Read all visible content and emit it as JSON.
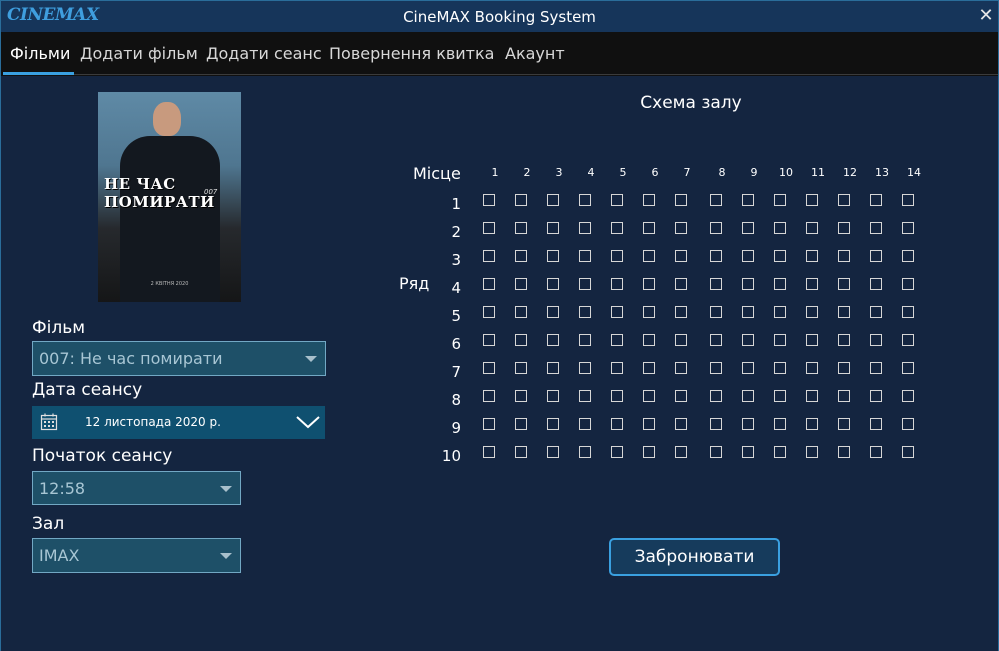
{
  "titlebar": {
    "logo": "CINEMAX",
    "title": "CineMAX Booking System",
    "close": "✕"
  },
  "tabs": [
    {
      "label": "Фільми",
      "active": true
    },
    {
      "label": "Додати фільм",
      "active": false
    },
    {
      "label": "Додати сеанс",
      "active": false
    },
    {
      "label": "Повернення квитка",
      "active": false
    },
    {
      "label": "Акаунт",
      "active": false
    }
  ],
  "poster": {
    "title_line1": "НЕ ЧАС",
    "title_line2": "ПОМИРАТИ",
    "brand": "007",
    "date": "2 КВІТНЯ 2020"
  },
  "form": {
    "film_label": "Фільм",
    "film_value": "007: Не час помирати",
    "date_label": "Дата сеансу",
    "date_value": "12 листопада 2020 р.",
    "start_label": "Початок сеансу",
    "start_value": "12:58",
    "hall_label": "Зал",
    "hall_value": "IMAX"
  },
  "scheme": {
    "title": "Схема залу",
    "seat_label": "Місце",
    "row_label": "Ряд",
    "columns": [
      "1",
      "2",
      "3",
      "4",
      "5",
      "6",
      "7",
      "8",
      "9",
      "10",
      "11",
      "12",
      "13",
      "14"
    ],
    "rows": [
      "1",
      "2",
      "3",
      "4",
      "5",
      "6",
      "7",
      "8",
      "9",
      "10"
    ]
  },
  "book_button": "Забронювати",
  "colors": {
    "accent": "#3aa0e0",
    "background": "#142540",
    "titlebar": "#16355a",
    "combo": "#1e5068",
    "datepicker": "#0f5070"
  }
}
